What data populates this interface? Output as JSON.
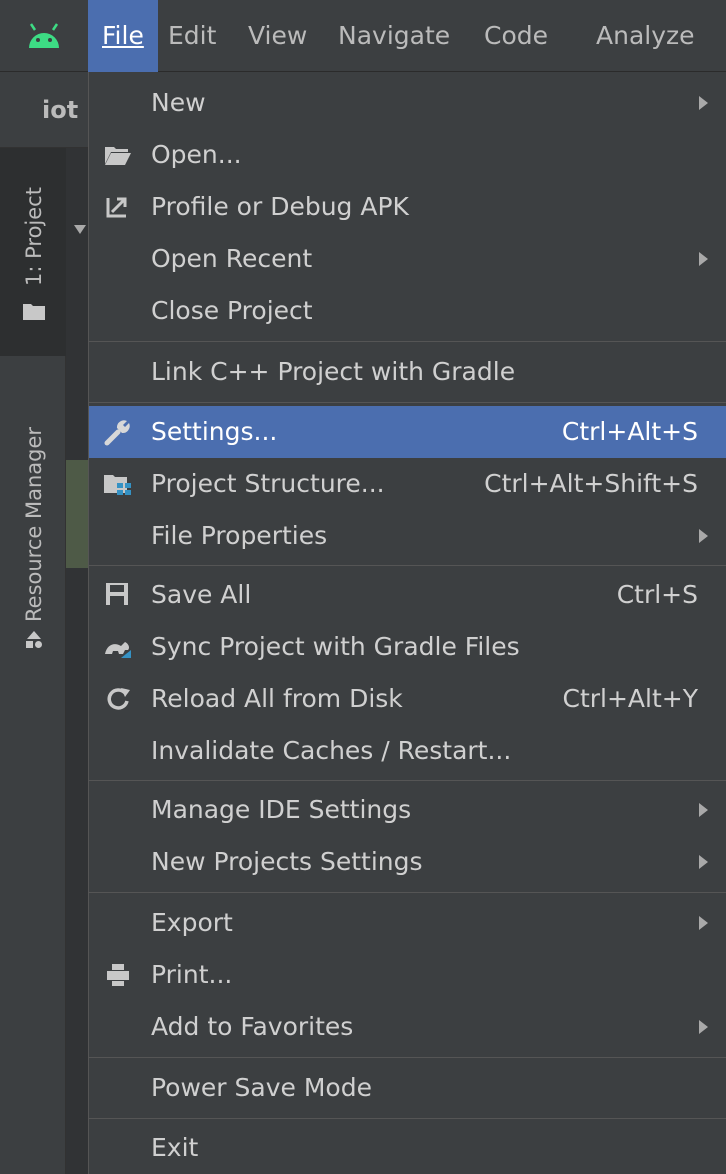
{
  "menubar": {
    "items": [
      "File",
      "Edit",
      "View",
      "Navigate",
      "Code",
      "Analyze"
    ]
  },
  "navbar": {
    "project_name": "iot"
  },
  "toolwindows": {
    "project": "1: Project",
    "resource_manager": "Resource Manager"
  },
  "file_menu": {
    "items": [
      {
        "label": "New",
        "shortcut": "",
        "submenu": true
      },
      {
        "label": "Open...",
        "shortcut": "",
        "icon": "folder-open-icon"
      },
      {
        "label": "Profile or Debug APK",
        "shortcut": "",
        "icon": "profile-apk-icon"
      },
      {
        "label": "Open Recent",
        "shortcut": "",
        "submenu": true
      },
      {
        "label": "Close Project",
        "shortcut": ""
      },
      {
        "label": "Link C++ Project with Gradle",
        "shortcut": ""
      },
      {
        "label": "Settings...",
        "shortcut": "Ctrl+Alt+S",
        "icon": "wrench-icon",
        "selected": true
      },
      {
        "label": "Project Structure...",
        "shortcut": "Ctrl+Alt+Shift+S",
        "icon": "project-structure-icon"
      },
      {
        "label": "File Properties",
        "shortcut": "",
        "submenu": true
      },
      {
        "label": "Save All",
        "shortcut": "Ctrl+S",
        "icon": "save-icon"
      },
      {
        "label": "Sync Project with Gradle Files",
        "shortcut": "",
        "icon": "gradle-sync-icon"
      },
      {
        "label": "Reload All from Disk",
        "shortcut": "Ctrl+Alt+Y",
        "icon": "reload-icon"
      },
      {
        "label": "Invalidate Caches / Restart...",
        "shortcut": ""
      },
      {
        "label": "Manage IDE Settings",
        "shortcut": "",
        "submenu": true
      },
      {
        "label": "New Projects Settings",
        "shortcut": "",
        "submenu": true
      },
      {
        "label": "Export",
        "shortcut": "",
        "submenu": true
      },
      {
        "label": "Print...",
        "shortcut": "",
        "icon": "printer-icon"
      },
      {
        "label": "Add to Favorites",
        "shortcut": "",
        "submenu": true
      },
      {
        "label": "Power Save Mode",
        "shortcut": ""
      },
      {
        "label": "Exit",
        "shortcut": ""
      }
    ]
  },
  "colors": {
    "menu_bg": "#3c3f41",
    "selection": "#4b6eaf",
    "android_green": "#3ddc84"
  }
}
